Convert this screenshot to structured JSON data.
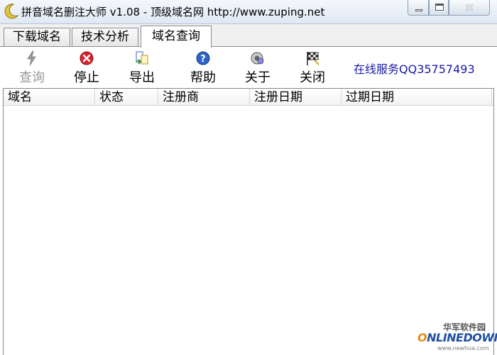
{
  "window": {
    "title": "拼音域名删注大师 v1.08 - 顶级域名网 http://www.zuping.net",
    "icon": "crescent-moon-icon",
    "close_glyph": "✕"
  },
  "tabs": [
    {
      "label": "下载域名",
      "active": false
    },
    {
      "label": "技术分析",
      "active": false
    },
    {
      "label": "域名查询",
      "active": true
    }
  ],
  "toolbar": {
    "query": {
      "label": "查询",
      "icon": "lightning-icon",
      "enabled": false
    },
    "stop": {
      "label": "停止",
      "icon": "stop-icon"
    },
    "export": {
      "label": "导出",
      "icon": "export-icon"
    },
    "help": {
      "label": "帮助",
      "icon": "help-icon"
    },
    "about": {
      "label": "关于",
      "icon": "about-icon"
    },
    "close": {
      "label": "关闭",
      "icon": "checkered-flag-icon"
    },
    "online_service": "在线服务QQ35757493"
  },
  "list": {
    "columns": [
      "域名",
      "状态",
      "注册商",
      "注册日期",
      "过期日期"
    ],
    "rows": []
  },
  "watermark": {
    "cn": "华军软件园",
    "en_o": "O",
    "en_rest": "NLINEDOWN",
    "url": "www.newhua.com"
  },
  "colors": {
    "online_text": "#1a1aa8",
    "stop_red": "#d9232a",
    "help_blue": "#2c64c8"
  }
}
